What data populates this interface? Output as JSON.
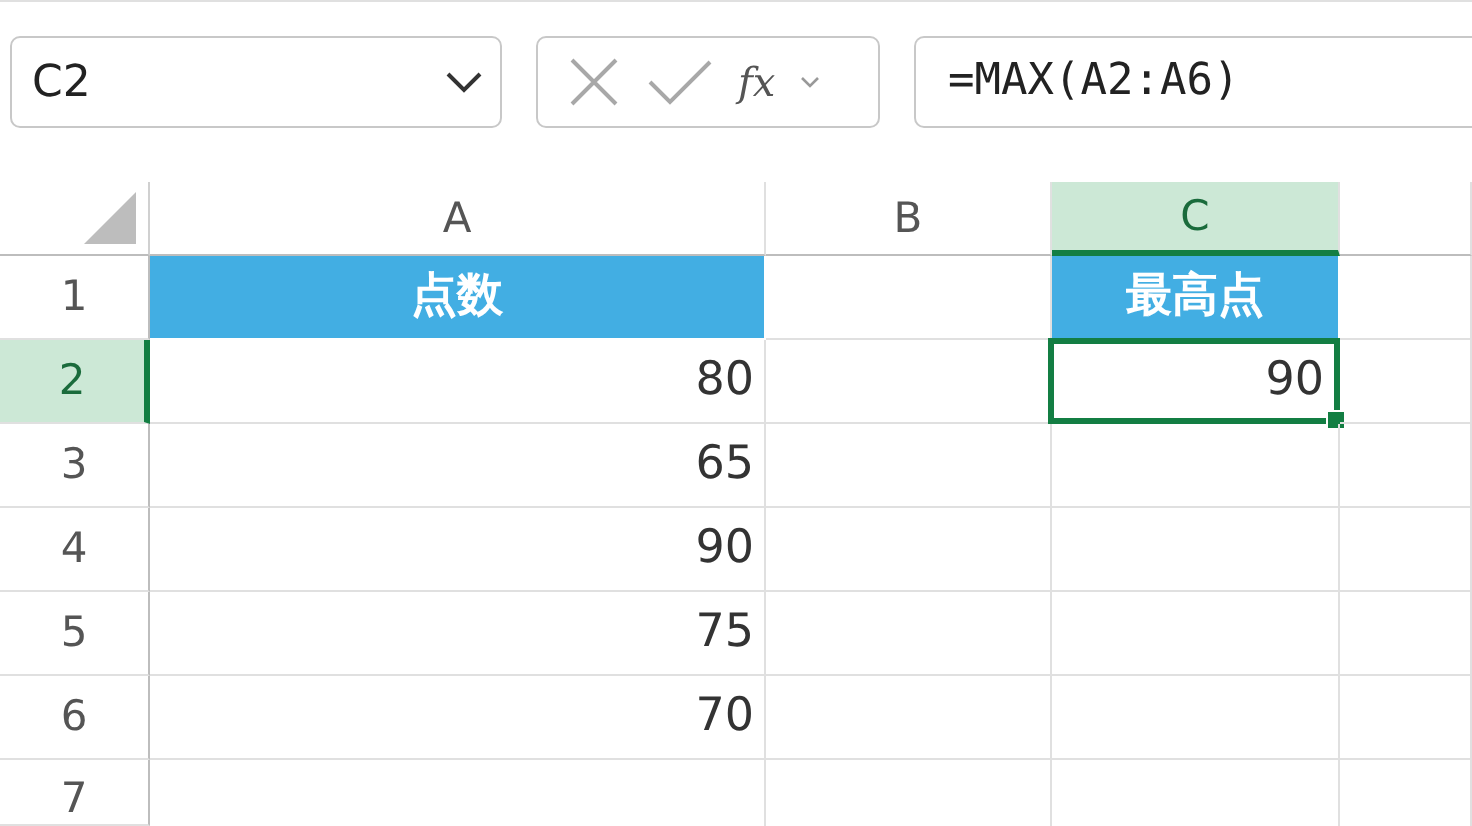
{
  "name_box": {
    "value": "C2"
  },
  "formula_bar": {
    "function_label": "fx",
    "formula": "=MAX(A2:A6)"
  },
  "columns": [
    {
      "kind": "letter",
      "label": "A",
      "selected": false
    },
    {
      "kind": "letter",
      "label": "B",
      "selected": false
    },
    {
      "kind": "letter",
      "label": "C",
      "selected": true
    },
    {
      "kind": "blank",
      "selected": false
    }
  ],
  "rows": [
    {
      "number": "1",
      "selected": false,
      "cells": [
        {
          "kind": "header",
          "text": "点数",
          "selected": false
        },
        {
          "kind": "empty",
          "selected": false
        },
        {
          "kind": "header",
          "text": "最高点",
          "selected": false
        },
        {
          "kind": "empty",
          "selected": false
        }
      ]
    },
    {
      "number": "2",
      "selected": true,
      "cells": [
        {
          "kind": "number",
          "text": "80",
          "selected": false
        },
        {
          "kind": "empty",
          "selected": false
        },
        {
          "kind": "number",
          "text": "90",
          "selected": true
        },
        {
          "kind": "empty",
          "selected": false
        }
      ]
    },
    {
      "number": "3",
      "selected": false,
      "cells": [
        {
          "kind": "number",
          "text": "65",
          "selected": false
        },
        {
          "kind": "empty",
          "selected": false
        },
        {
          "kind": "empty",
          "selected": false
        },
        {
          "kind": "empty",
          "selected": false
        }
      ]
    },
    {
      "number": "4",
      "selected": false,
      "cells": [
        {
          "kind": "number",
          "text": "90",
          "selected": false
        },
        {
          "kind": "empty",
          "selected": false
        },
        {
          "kind": "empty",
          "selected": false
        },
        {
          "kind": "empty",
          "selected": false
        }
      ]
    },
    {
      "number": "5",
      "selected": false,
      "cells": [
        {
          "kind": "number",
          "text": "75",
          "selected": false
        },
        {
          "kind": "empty",
          "selected": false
        },
        {
          "kind": "empty",
          "selected": false
        },
        {
          "kind": "empty",
          "selected": false
        }
      ]
    },
    {
      "number": "6",
      "selected": false,
      "cells": [
        {
          "kind": "number",
          "text": "70",
          "selected": false
        },
        {
          "kind": "empty",
          "selected": false
        },
        {
          "kind": "empty",
          "selected": false
        },
        {
          "kind": "empty",
          "selected": false
        }
      ]
    },
    {
      "number": "7",
      "selected": false,
      "cells": [
        {
          "kind": "empty",
          "selected": false
        },
        {
          "kind": "empty",
          "selected": false
        },
        {
          "kind": "empty",
          "selected": false
        },
        {
          "kind": "empty",
          "selected": false
        }
      ]
    }
  ]
}
